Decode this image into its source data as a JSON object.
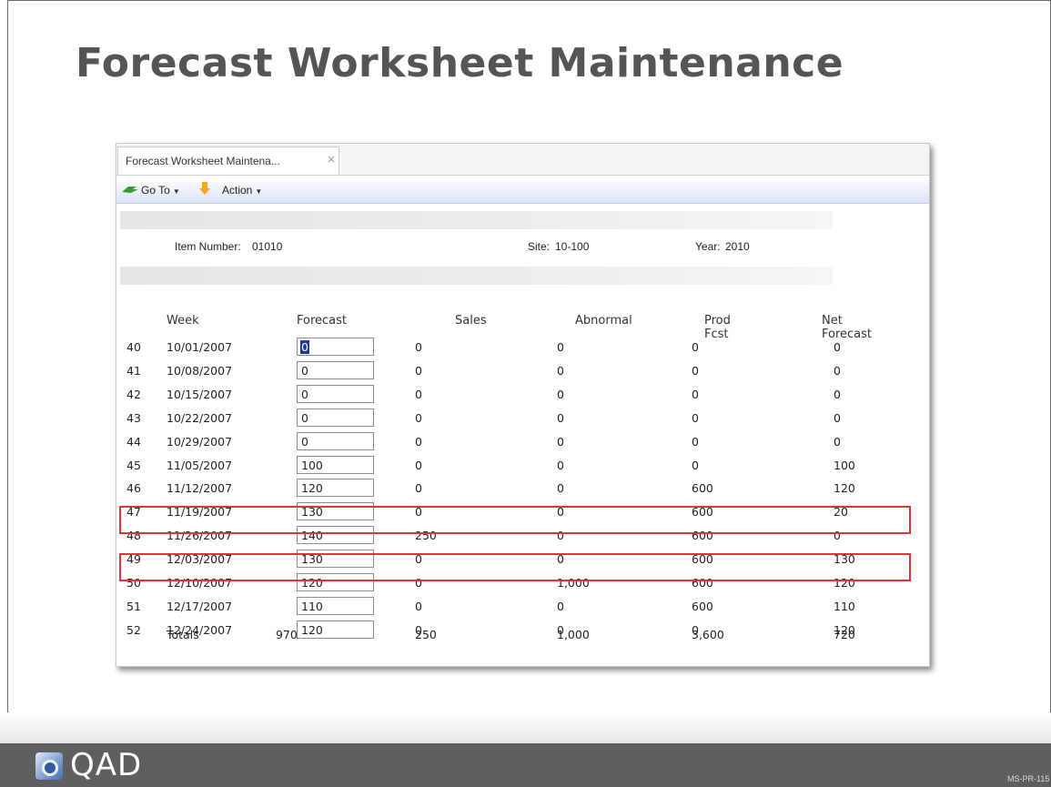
{
  "slide": {
    "title": "Forecast Worksheet Maintenance",
    "page_code": "MS-PR-115",
    "logo_text": "QAD"
  },
  "window": {
    "tab_label": "Forecast Worksheet Maintena...",
    "tab_close": "×",
    "toolbar": {
      "goto_label": "Go To",
      "action_label": "Action",
      "caret": "▼"
    },
    "header": {
      "item_number_label": "Item Number:",
      "item_number_value": "01010",
      "site_label": "Site:",
      "site_value": "10-100",
      "year_label": "Year:",
      "year_value": "2010"
    },
    "columns": {
      "week": "Week",
      "forecast": "Forecast",
      "sales": "Sales",
      "abnormal": "Abnormal",
      "prod_fcst": "Prod Fcst",
      "net_forecast": "Net Forecast"
    },
    "rows": [
      {
        "num": "40",
        "week": "10/01/2007",
        "forecast": "0",
        "sales": "0",
        "abnormal": "0",
        "prod_fcst": "0",
        "net_forecast": "0"
      },
      {
        "num": "41",
        "week": "10/08/2007",
        "forecast": "0",
        "sales": "0",
        "abnormal": "0",
        "prod_fcst": "0",
        "net_forecast": "0"
      },
      {
        "num": "42",
        "week": "10/15/2007",
        "forecast": "0",
        "sales": "0",
        "abnormal": "0",
        "prod_fcst": "0",
        "net_forecast": "0"
      },
      {
        "num": "43",
        "week": "10/22/2007",
        "forecast": "0",
        "sales": "0",
        "abnormal": "0",
        "prod_fcst": "0",
        "net_forecast": "0"
      },
      {
        "num": "44",
        "week": "10/29/2007",
        "forecast": "0",
        "sales": "0",
        "abnormal": "0",
        "prod_fcst": "0",
        "net_forecast": "0"
      },
      {
        "num": "45",
        "week": "11/05/2007",
        "forecast": "100",
        "sales": "0",
        "abnormal": "0",
        "prod_fcst": "0",
        "net_forecast": "100"
      },
      {
        "num": "46",
        "week": "11/12/2007",
        "forecast": "120",
        "sales": "0",
        "abnormal": "0",
        "prod_fcst": "600",
        "net_forecast": "120"
      },
      {
        "num": "47",
        "week": "11/19/2007",
        "forecast": "130",
        "sales": "0",
        "abnormal": "0",
        "prod_fcst": "600",
        "net_forecast": "20"
      },
      {
        "num": "48",
        "week": "11/26/2007",
        "forecast": "140",
        "sales": "250",
        "abnormal": "0",
        "prod_fcst": "600",
        "net_forecast": "0"
      },
      {
        "num": "49",
        "week": "12/03/2007",
        "forecast": "130",
        "sales": "0",
        "abnormal": "0",
        "prod_fcst": "600",
        "net_forecast": "130"
      },
      {
        "num": "50",
        "week": "12/10/2007",
        "forecast": "120",
        "sales": "0",
        "abnormal": "1,000",
        "prod_fcst": "600",
        "net_forecast": "120"
      },
      {
        "num": "51",
        "week": "12/17/2007",
        "forecast": "110",
        "sales": "0",
        "abnormal": "0",
        "prod_fcst": "600",
        "net_forecast": "110"
      },
      {
        "num": "52",
        "week": "12/24/2007",
        "forecast": "120",
        "sales": "0",
        "abnormal": "0",
        "prod_fcst": "0",
        "net_forecast": "120"
      }
    ],
    "totals": {
      "label": "Totals",
      "forecast": "970",
      "sales": "250",
      "abnormal": "1,000",
      "prod_fcst": "3,600",
      "net_forecast": "720"
    },
    "highlighted_weeks": [
      "48",
      "50"
    ],
    "highlight_color": "#e0343c",
    "selection_color": "#1a3c9c"
  },
  "icons": {
    "goto": "goto-arrow-icon",
    "action": "action-arrow-icon",
    "close": "close-icon",
    "logo": "qad-logo-icon"
  }
}
